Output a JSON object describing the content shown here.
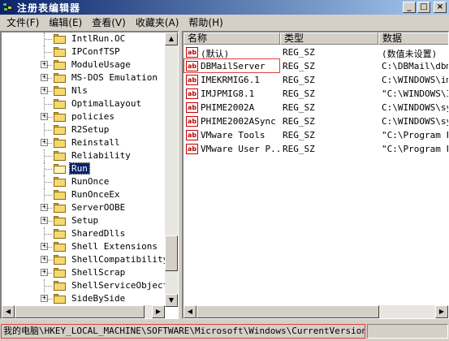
{
  "window": {
    "title": "注册表编辑器"
  },
  "menu": [
    "文件(F)",
    "编辑(E)",
    "查看(V)",
    "收藏夹(A)",
    "帮助(H)"
  ],
  "tree": {
    "items": [
      {
        "label": "IntlRun.OC",
        "expander": ""
      },
      {
        "label": "IPConfTSP",
        "expander": ""
      },
      {
        "label": "ModuleUsage",
        "expander": "+"
      },
      {
        "label": "MS-DOS Emulation",
        "expander": "+"
      },
      {
        "label": "Nls",
        "expander": "+"
      },
      {
        "label": "OptimalLayout",
        "expander": ""
      },
      {
        "label": "policies",
        "expander": "+"
      },
      {
        "label": "R2Setup",
        "expander": ""
      },
      {
        "label": "Reinstall",
        "expander": "+"
      },
      {
        "label": "Reliability",
        "expander": ""
      },
      {
        "label": "Run",
        "expander": "",
        "selected": true
      },
      {
        "label": "RunOnce",
        "expander": ""
      },
      {
        "label": "RunOnceEx",
        "expander": ""
      },
      {
        "label": "ServerOOBE",
        "expander": "+"
      },
      {
        "label": "Setup",
        "expander": "+"
      },
      {
        "label": "SharedDlls",
        "expander": ""
      },
      {
        "label": "Shell Extensions",
        "expander": "+"
      },
      {
        "label": "ShellCompatibility",
        "expander": "+"
      },
      {
        "label": "ShellScrap",
        "expander": "+"
      },
      {
        "label": "ShellServiceObjectD",
        "expander": ""
      },
      {
        "label": "SideBySide",
        "expander": "+"
      }
    ]
  },
  "list": {
    "headers": [
      "名称",
      "类型",
      "数据"
    ],
    "rows": [
      {
        "name": "(默认)",
        "type": "REG_SZ",
        "data": "(数值未设置)"
      },
      {
        "name": "DBMailServer",
        "type": "REG_SZ",
        "data": "C:\\DBMail\\dbm"
      },
      {
        "name": "IMEKRMIG6.1",
        "type": "REG_SZ",
        "data": "C:\\WINDOWS\\im"
      },
      {
        "name": "IMJPMIG8.1",
        "type": "REG_SZ",
        "data": "\"C:\\WINDOWS\\I"
      },
      {
        "name": "PHIME2002A",
        "type": "REG_SZ",
        "data": "C:\\WINDOWS\\sy"
      },
      {
        "name": "PHIME2002ASync",
        "type": "REG_SZ",
        "data": "C:\\WINDOWS\\sy"
      },
      {
        "name": "VMware Tools",
        "type": "REG_SZ",
        "data": "\"C:\\Program F"
      },
      {
        "name": "VMware User P...",
        "type": "REG_SZ",
        "data": "\"C:\\Program F"
      }
    ]
  },
  "statusbar": {
    "path": "我的电脑\\HKEY_LOCAL_MACHINE\\SOFTWARE\\Microsoft\\Windows\\CurrentVersion\\Run"
  },
  "icons": {
    "value": "ab",
    "scroll_up": "▲",
    "scroll_down": "▼",
    "scroll_left": "◀",
    "scroll_right": "▶",
    "minimize": "_",
    "maximize": "□",
    "close": "×"
  },
  "colors": {
    "titlebar": "#0a246a",
    "selection": "#0a246a",
    "highlight": "#e04040"
  }
}
